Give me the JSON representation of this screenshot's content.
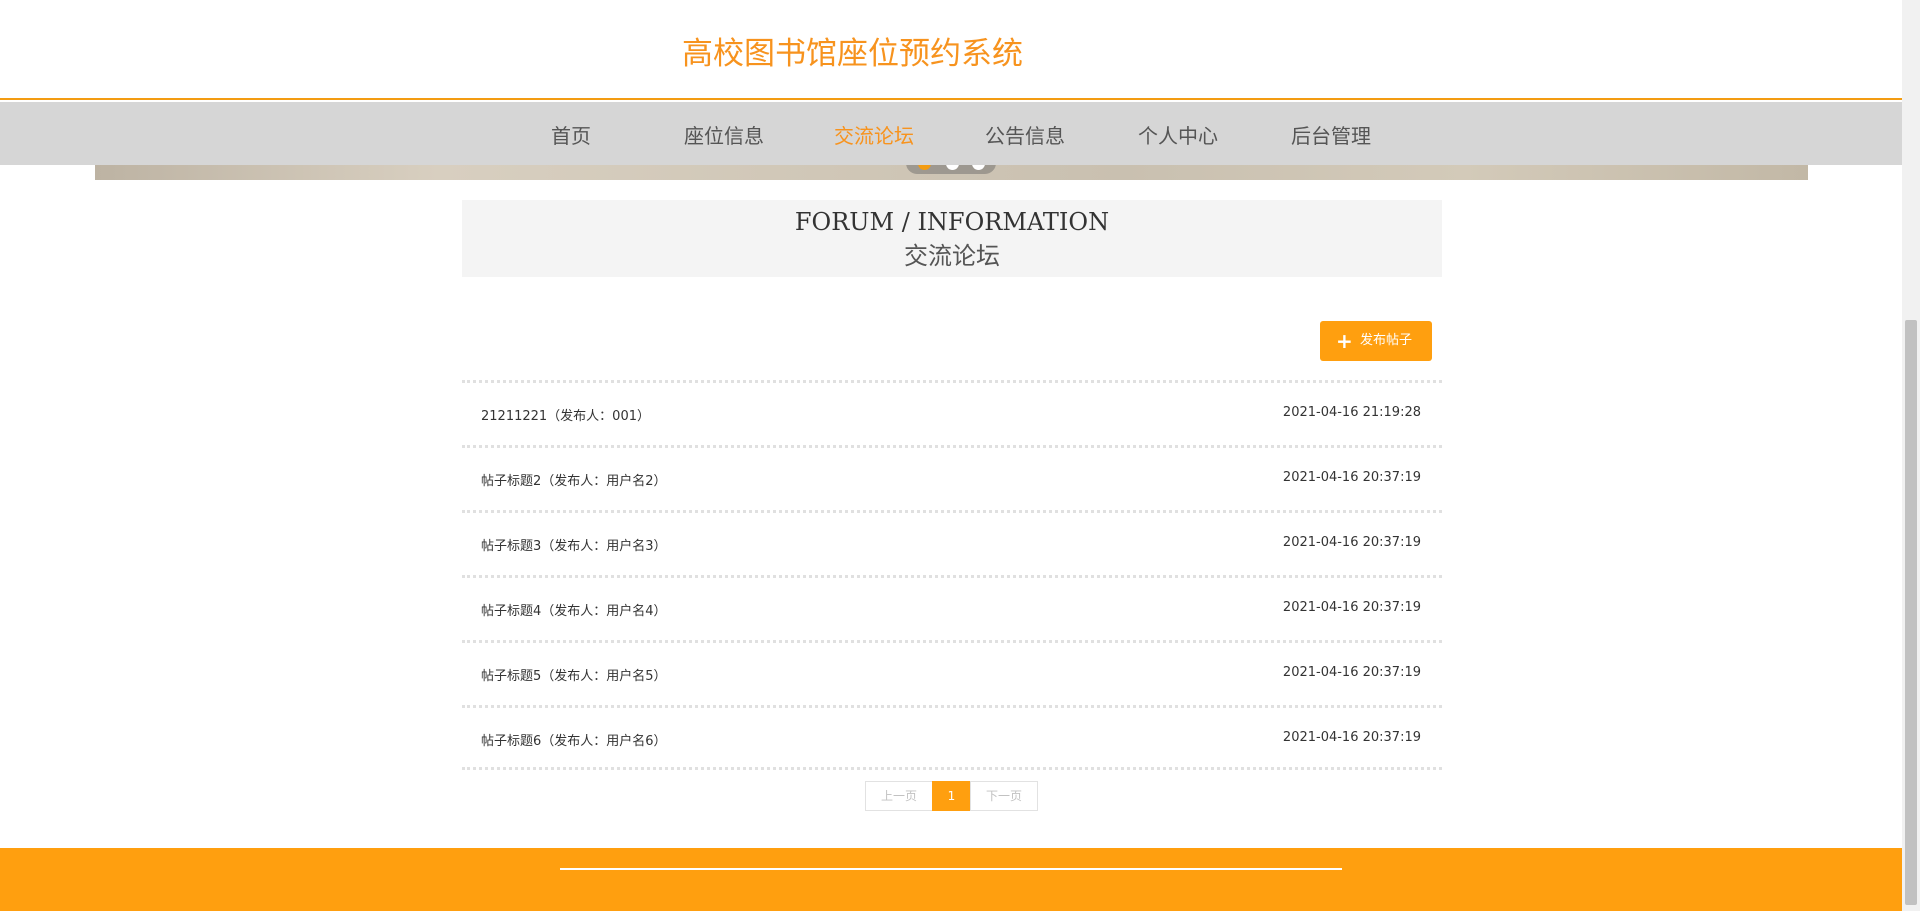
{
  "header": {
    "site_title": "高校图书馆座位预约系统"
  },
  "nav": {
    "items": [
      {
        "label": "首页",
        "active": false
      },
      {
        "label": "座位信息",
        "active": false
      },
      {
        "label": "交流论坛",
        "active": true
      },
      {
        "label": "公告信息",
        "active": false
      },
      {
        "label": "个人中心",
        "active": false
      },
      {
        "label": "后台管理",
        "active": false
      }
    ]
  },
  "banner": {
    "dot_count": 3,
    "active_dot": 1
  },
  "section": {
    "title_en": "FORUM / INFORMATION",
    "title_cn": "交流论坛"
  },
  "toolbar": {
    "publish_label": "发布帖子",
    "publish_icon": "plus-icon"
  },
  "posts": [
    {
      "title": "21211221（发布人：001）",
      "time": "2021-04-16 21:19:28"
    },
    {
      "title": "帖子标题2（发布人：用户名2）",
      "time": "2021-04-16 20:37:19"
    },
    {
      "title": "帖子标题3（发布人：用户名3）",
      "time": "2021-04-16 20:37:19"
    },
    {
      "title": "帖子标题4（发布人：用户名4）",
      "time": "2021-04-16 20:37:19"
    },
    {
      "title": "帖子标题5（发布人：用户名5）",
      "time": "2021-04-16 20:37:19"
    },
    {
      "title": "帖子标题6（发布人：用户名6）",
      "time": "2021-04-16 20:37:19"
    }
  ],
  "pagination": {
    "prev_label": "上一页",
    "current_page": "1",
    "next_label": "下一页"
  },
  "colors": {
    "accent": "#f7931e",
    "button": "#ff9f0f",
    "nav_bg": "#d6d6d6"
  }
}
